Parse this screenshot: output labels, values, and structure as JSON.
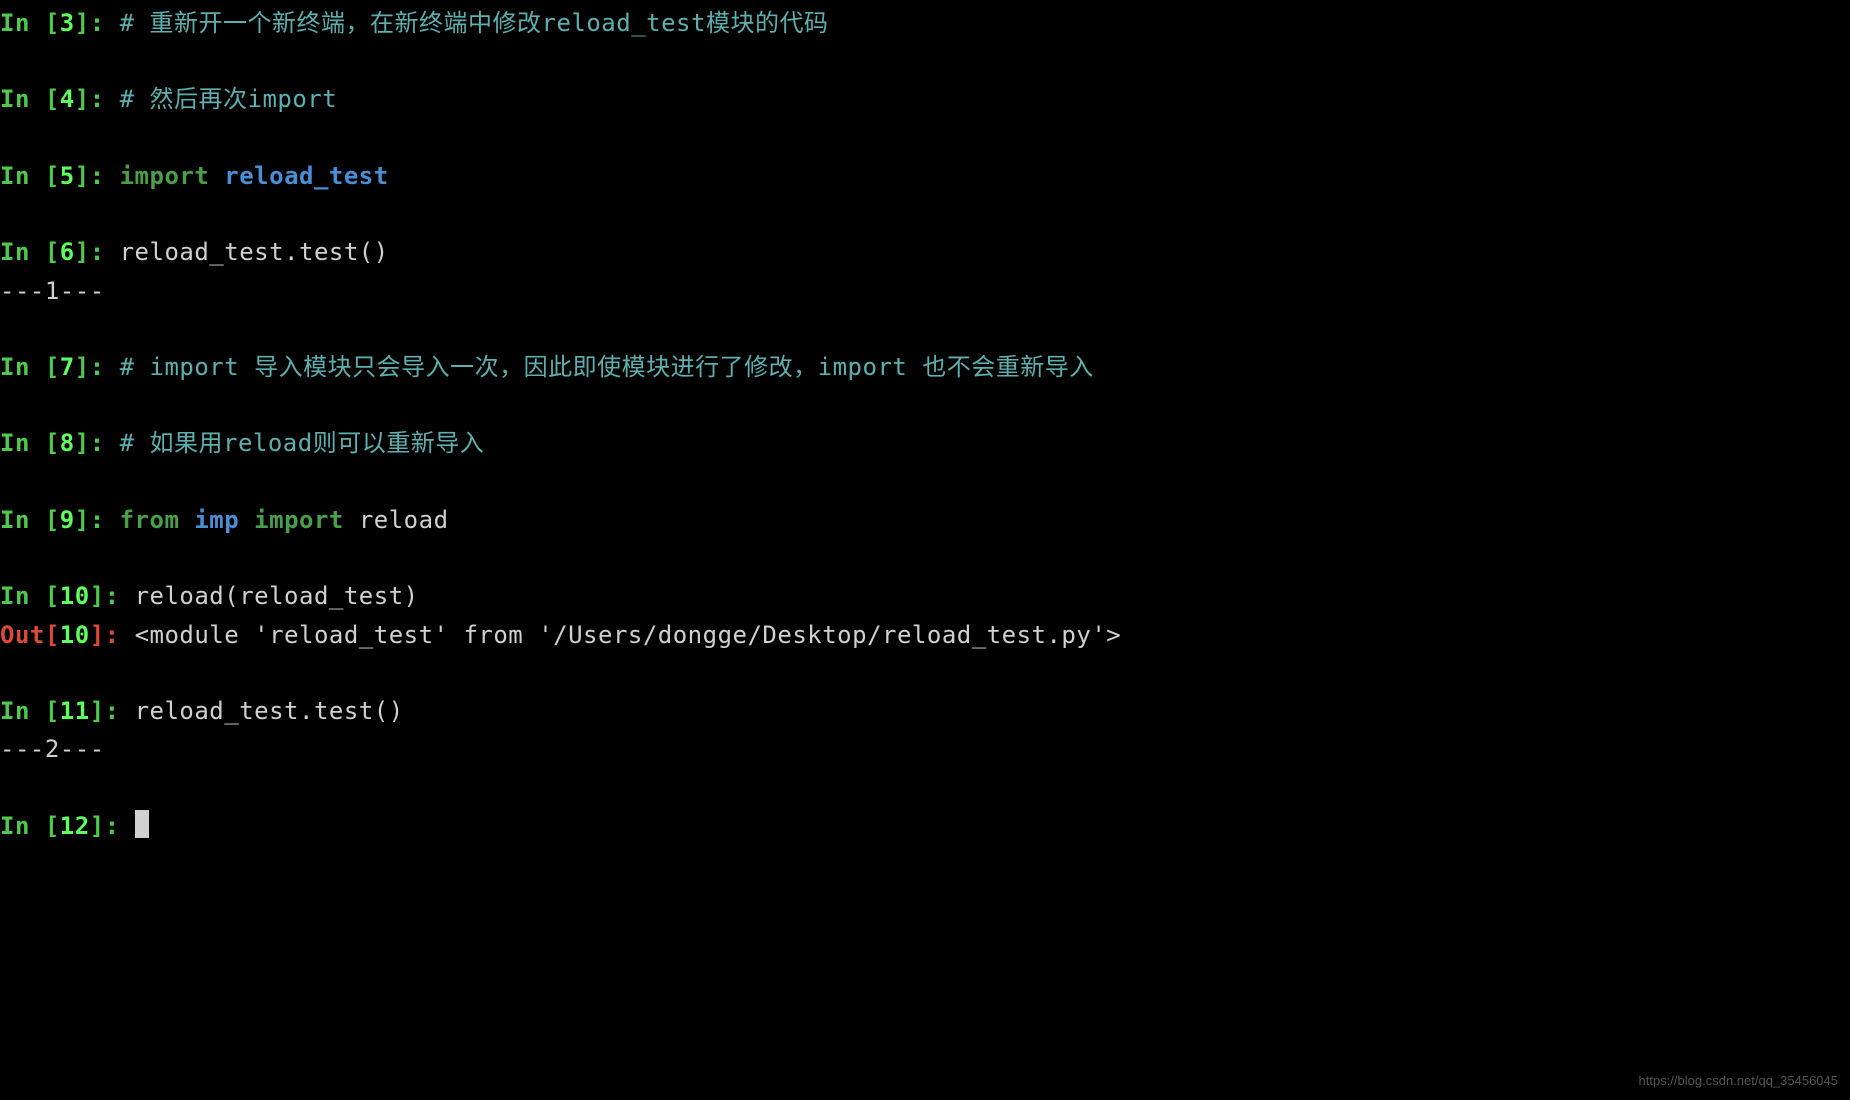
{
  "cells": [
    {
      "type": "in",
      "num": "3",
      "content": [
        {
          "kind": "comment",
          "text": "# 重新开一个新终端，在新终端中修改reload_test模块的代码"
        }
      ]
    },
    {
      "type": "blank"
    },
    {
      "type": "in",
      "num": "4",
      "content": [
        {
          "kind": "comment",
          "text": "# 然后再次import"
        }
      ]
    },
    {
      "type": "blank"
    },
    {
      "type": "in",
      "num": "5",
      "content": [
        {
          "kind": "keyword",
          "text": "import"
        },
        {
          "kind": "code",
          "text": " "
        },
        {
          "kind": "module",
          "text": "reload_test"
        }
      ]
    },
    {
      "type": "blank"
    },
    {
      "type": "in",
      "num": "6",
      "content": [
        {
          "kind": "code",
          "text": "reload_test.test()"
        }
      ]
    },
    {
      "type": "output",
      "text": "---1---"
    },
    {
      "type": "blank"
    },
    {
      "type": "in",
      "num": "7",
      "content": [
        {
          "kind": "comment",
          "text": "# import 导入模块只会导入一次，因此即使模块进行了修改，import 也不会重新导入"
        }
      ]
    },
    {
      "type": "blank"
    },
    {
      "type": "in",
      "num": "8",
      "content": [
        {
          "kind": "comment",
          "text": "# 如果用reload则可以重新导入"
        }
      ]
    },
    {
      "type": "blank"
    },
    {
      "type": "in",
      "num": "9",
      "content": [
        {
          "kind": "keyword",
          "text": "from"
        },
        {
          "kind": "code",
          "text": " "
        },
        {
          "kind": "module",
          "text": "imp"
        },
        {
          "kind": "code",
          "text": " "
        },
        {
          "kind": "keyword",
          "text": "import"
        },
        {
          "kind": "code",
          "text": " reload"
        }
      ]
    },
    {
      "type": "blank"
    },
    {
      "type": "in",
      "num": "10",
      "content": [
        {
          "kind": "code",
          "text": "reload(reload_test)"
        }
      ]
    },
    {
      "type": "out",
      "num": "10",
      "content": [
        {
          "kind": "code",
          "text": "<module 'reload_test' from '/Users/dongge/Desktop/reload_test.py'>"
        }
      ]
    },
    {
      "type": "blank"
    },
    {
      "type": "in",
      "num": "11",
      "content": [
        {
          "kind": "code",
          "text": "reload_test.test()"
        }
      ]
    },
    {
      "type": "output",
      "text": "---2---"
    },
    {
      "type": "blank"
    },
    {
      "type": "in",
      "num": "12",
      "content": [],
      "cursor": true
    }
  ],
  "watermark": "https://blog.csdn.net/qq_35456045"
}
